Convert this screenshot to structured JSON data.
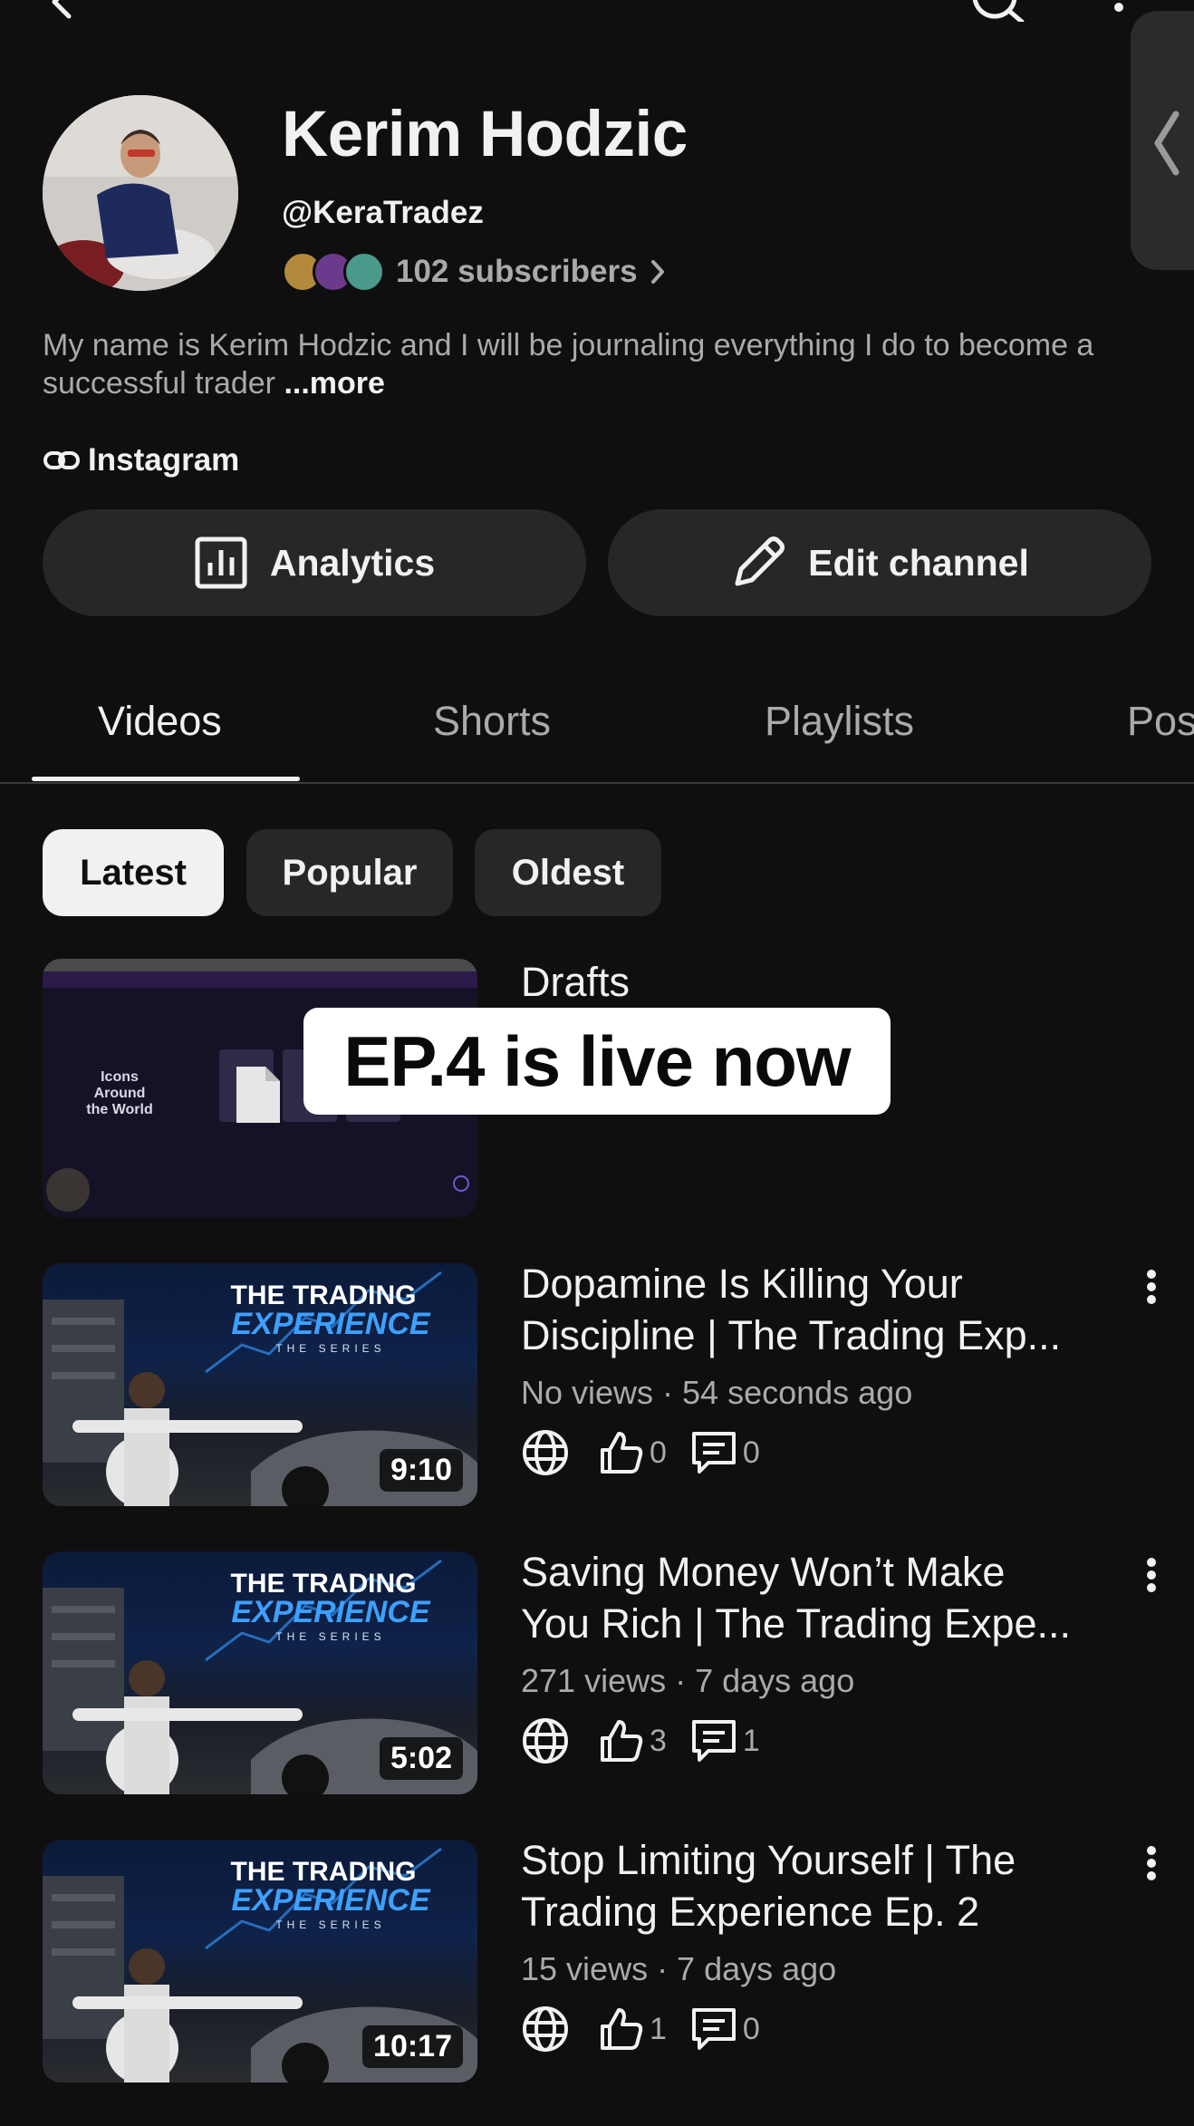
{
  "channel": {
    "name": "Kerim Hodzic",
    "handle": "@KeraTradez",
    "subscribers": "102 subscribers",
    "description": "My name is Kerim Hodzic and I will be journaling everything I do to become a successful trader ",
    "more_label": "...more",
    "link_label": "Instagram"
  },
  "actions": {
    "analytics_label": "Analytics",
    "edit_label": "Edit channel"
  },
  "tabs": [
    {
      "label": "Videos",
      "active": true
    },
    {
      "label": "Shorts",
      "active": false
    },
    {
      "label": "Playlists",
      "active": false
    },
    {
      "label": "Pos",
      "active": false
    }
  ],
  "filters": [
    {
      "label": "Latest",
      "active": true
    },
    {
      "label": "Popular",
      "active": false
    },
    {
      "label": "Oldest",
      "active": false
    }
  ],
  "drafts": {
    "label": "Drafts",
    "overlay_text": "EP.4 is live now"
  },
  "videos": [
    {
      "title_line1": "Dopamine Is Killing Your",
      "title_line2": "Discipline | The Trading Exp...",
      "meta": "No views · 54 seconds ago",
      "likes": "0",
      "comments": "0",
      "duration": "9:10"
    },
    {
      "title_line1": "Saving Money Won’t Make",
      "title_line2": "You Rich | The Trading Expe...",
      "meta": "271 views · 7 days ago",
      "likes": "3",
      "comments": "1",
      "duration": "5:02"
    },
    {
      "title_line1": "Stop Limiting Yourself | The",
      "title_line2": "Trading Experience Ep. 2",
      "meta": "15 views · 7 days ago",
      "likes": "1",
      "comments": "0",
      "duration": "10:17"
    }
  ],
  "thumb_text": {
    "line1": "THE TRADING",
    "line2": "EXPERIENCE",
    "line3": "THE SERIES"
  },
  "colors": {
    "background": "#0f0f0f",
    "surface": "#272727",
    "text_primary": "#f1f1f1",
    "text_secondary": "#aaaaaa",
    "thumb_accent": "#2f8ff0"
  },
  "icons": [
    "back-icon",
    "search-icon",
    "more-vert-icon",
    "chevron-left-icon",
    "chevron-right-icon",
    "link-icon",
    "analytics-icon",
    "pencil-icon",
    "globe-icon",
    "thumbs-up-icon",
    "comment-icon",
    "document-icon"
  ]
}
